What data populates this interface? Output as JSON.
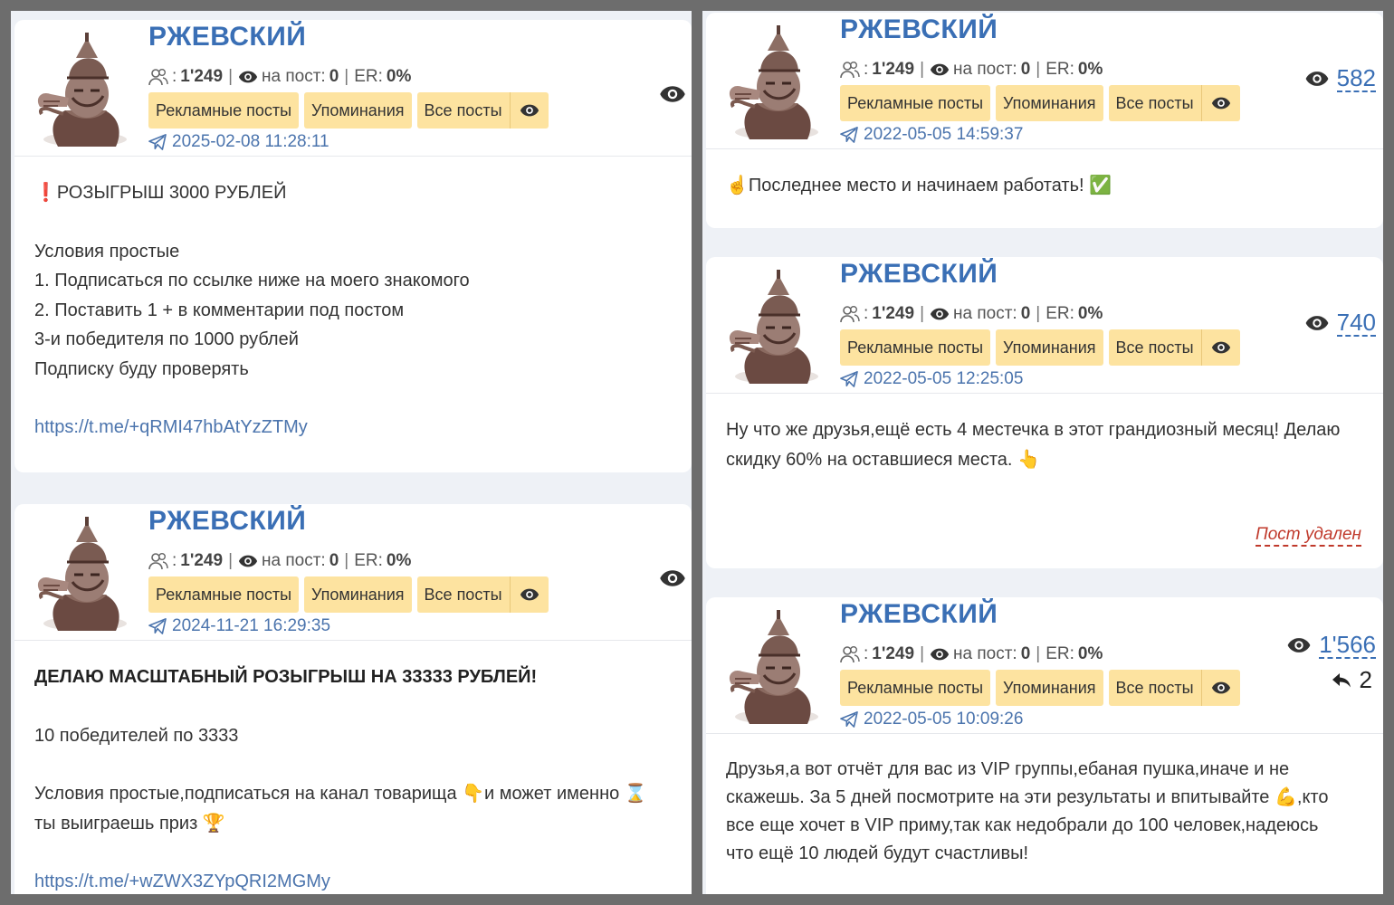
{
  "channel_name": "РЖЕВСКИЙ",
  "stats": {
    "subscribers": "1'249",
    "reach_label": "на пост:",
    "reach": "0",
    "er_label": "ER:",
    "er": "0%"
  },
  "buttons": {
    "ads": "Рекламные посты",
    "mentions": "Упоминания",
    "all": "Все посты"
  },
  "posts": [
    {
      "date": "2025-02-08 11:28:11",
      "lines": [
        "❗РОЗЫГРЫШ 3000 РУБЛЕЙ",
        "Условия простые",
        "1. Подписаться по ссылке ниже на моего знакомого",
        "2. Поставить 1 + в комментарии под постом",
        "3-и победителя по 1000 рублей",
        "Подписку буду проверять",
        "https://t.me/+qRMI47hbAtYzZTMy"
      ]
    },
    {
      "date": "2024-11-21 16:29:35",
      "lines": [
        "ДЕЛАЮ МАСШТАБНЫЙ РОЗЫГРЫШ НА 33333 РУБЛЕЙ!",
        "10 победителей по 3333",
        "Условия простые,подписаться на канал товарища 👇и может именно ⌛",
        "ты выиграешь приз 🏆",
        "https://t.me/+wZWX3ZYpQRI2MGMy"
      ]
    },
    {
      "date": "2022-05-05 14:59:37",
      "views": "582",
      "lines": [
        "☝Последнее место и начинаем работать! ✅"
      ]
    },
    {
      "date": "2022-05-05 12:25:05",
      "views": "740",
      "lines": [
        "Ну что же друзья,ещё есть 4 местечка в этот грандиозный месяц! Делаю",
        "скидку 60% на оставшиеся места. 👆"
      ],
      "status": "Пост удален"
    },
    {
      "date": "2022-05-05 10:09:26",
      "views": "1'566",
      "forwards": "2",
      "lines": [
        "Друзья,а вот отчёт для вас из VIP группы,ебаная пушка,иначе и не",
        "скажешь. За 5 дней посмотрите на эти результаты и впитывайте 💪,кто",
        "все еще хочет в VIP приму,так как недобрали до 100 человек,надеюсь",
        "что ещё 10 людей будут счастливы!"
      ]
    }
  ]
}
